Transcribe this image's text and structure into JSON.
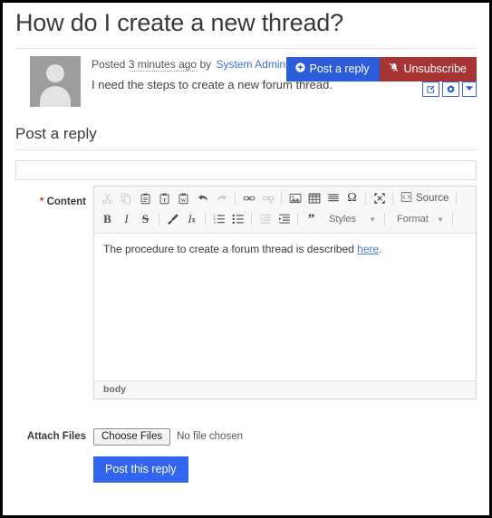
{
  "thread": {
    "title": "How do I create a new thread?",
    "actions": {
      "post_reply_label": "Post a reply",
      "unsubscribe_label": "Unsubscribe",
      "edit_icon": "edit-square-icon",
      "gear_icon": "gear-icon",
      "caret_icon": "caret-down-icon"
    },
    "post": {
      "avatar_alt": "user-avatar",
      "posted_prefix": "Posted",
      "time_ago": "3 minutes ago",
      "by_label": "by",
      "author": "System Administrator",
      "body": "I need the steps to create a new forum thread."
    }
  },
  "reply": {
    "heading": "Post a reply",
    "subject": {
      "value": "",
      "placeholder": ""
    },
    "content_label": "Content",
    "required_marker": "*",
    "editor": {
      "toolbar_row1": [
        {
          "name": "cut-icon",
          "title": "Cut",
          "dim": true
        },
        {
          "name": "copy-icon",
          "title": "Copy",
          "dim": true
        },
        {
          "name": "paste-icon",
          "title": "Paste",
          "dim": false
        },
        {
          "name": "paste-text-icon",
          "title": "Paste as plain text",
          "dim": false
        },
        {
          "name": "paste-word-icon",
          "title": "Paste from Word",
          "dim": false
        },
        {
          "name": "undo-icon",
          "title": "Undo",
          "dim": false
        },
        {
          "name": "redo-icon",
          "title": "Redo",
          "dim": true
        },
        {
          "name": "link-icon",
          "title": "Link",
          "dim": false
        },
        {
          "name": "unlink-icon",
          "title": "Unlink",
          "dim": true
        },
        {
          "name": "image-icon",
          "title": "Image",
          "dim": false
        },
        {
          "name": "table-icon",
          "title": "Table",
          "dim": false
        },
        {
          "name": "horizontal-rule-icon",
          "title": "Horizontal Line",
          "dim": false
        },
        {
          "name": "special-char-icon",
          "title": "Special Character",
          "dim": false
        },
        {
          "name": "maximize-icon",
          "title": "Maximize",
          "dim": false
        }
      ],
      "source_label": "Source",
      "source_icon": "source-code-icon",
      "toolbar_row2": [
        {
          "name": "bold-icon",
          "title": "Bold",
          "dim": false
        },
        {
          "name": "italic-icon",
          "title": "Italic",
          "dim": false
        },
        {
          "name": "strikethrough-icon",
          "title": "Strikethrough",
          "dim": false
        },
        {
          "name": "copy-formatting-icon",
          "title": "Copy Formatting",
          "dim": false
        },
        {
          "name": "remove-format-icon",
          "title": "Remove Format",
          "dim": false
        },
        {
          "name": "numbered-list-icon",
          "title": "Numbered List",
          "dim": false
        },
        {
          "name": "bulleted-list-icon",
          "title": "Bulleted List",
          "dim": false
        },
        {
          "name": "outdent-icon",
          "title": "Decrease Indent",
          "dim": true
        },
        {
          "name": "indent-icon",
          "title": "Increase Indent",
          "dim": false
        },
        {
          "name": "blockquote-icon",
          "title": "Block Quote",
          "dim": false
        }
      ],
      "styles_label": "Styles",
      "format_label": "Format",
      "content_text_before": "The procedure to create a forum thread is described ",
      "content_link_text": "here",
      "content_text_after": ".",
      "status_path": "body"
    },
    "attach": {
      "label": "Attach Files",
      "button_label": "Choose Files",
      "file_status": "No file chosen"
    },
    "submit_label": "Post this reply"
  },
  "colors": {
    "primary_blue": "#2b5cd9",
    "submit_blue": "#3366ee",
    "danger_red": "#a63434",
    "link_blue": "#3b6fd4",
    "required_red": "#c0392b"
  }
}
